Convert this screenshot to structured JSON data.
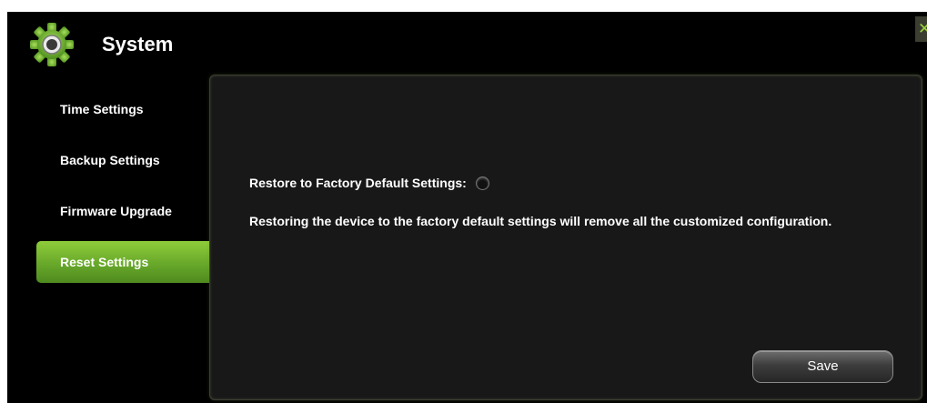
{
  "header": {
    "title": "System",
    "icon": "gear-icon",
    "close_icon": "close-icon"
  },
  "sidebar": {
    "items": [
      {
        "label": "Time Settings",
        "active": false
      },
      {
        "label": "Backup Settings",
        "active": false
      },
      {
        "label": "Firmware Upgrade",
        "active": false
      },
      {
        "label": "Reset Settings",
        "active": true
      }
    ]
  },
  "main": {
    "reset_label": "Restore to Factory Default Settings:",
    "reset_selected": false,
    "description": "Restoring the device to the factory default settings will remove all the customized configuration.",
    "save_label": "Save"
  },
  "colors": {
    "accent": "#7ab833",
    "background": "#000000",
    "panel": "#181818"
  }
}
